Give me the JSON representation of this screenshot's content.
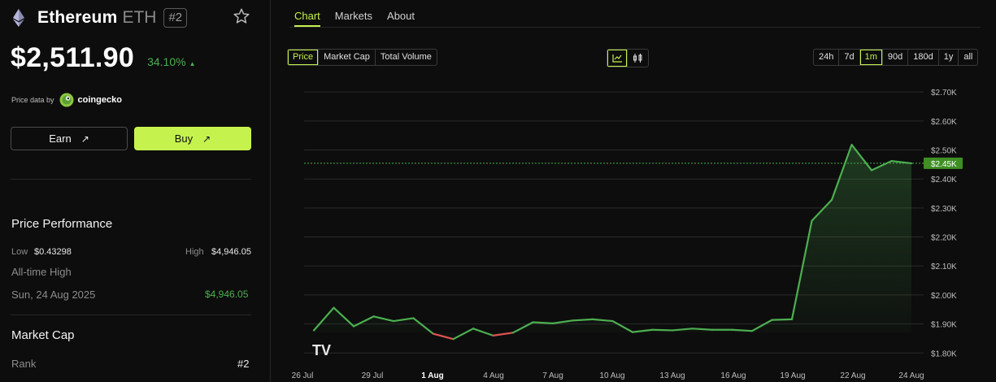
{
  "coin": {
    "name": "Ethereum",
    "symbol": "ETH",
    "rank_badge": "#2",
    "price": "$2,511.90",
    "change_pct": "34.10%",
    "price_data_label": "Price data by",
    "provider": "coingecko"
  },
  "actions": {
    "earn": "Earn",
    "buy": "Buy",
    "arrow": "↗"
  },
  "performance": {
    "title": "Price Performance",
    "low_label": "Low",
    "low_value": "$0.43298",
    "high_label": "High",
    "high_value": "$4,946.05",
    "ath_label": "All-time High",
    "ath_date": "Sun, 24 Aug 2025",
    "ath_value": "$4,946.05"
  },
  "market_cap": {
    "title": "Market Cap",
    "rank_label": "Rank",
    "rank_value": "#2"
  },
  "tabs": [
    {
      "label": "Chart",
      "active": true
    },
    {
      "label": "Markets",
      "active": false
    },
    {
      "label": "About",
      "active": false
    }
  ],
  "metric_options": [
    "Price",
    "Market Cap",
    "Total Volume"
  ],
  "metric_selected": "Price",
  "chart_type_icons": [
    "line-chart-icon",
    "candlestick-icon"
  ],
  "range_options": [
    "24h",
    "7d",
    "1m",
    "90d",
    "180d",
    "1y",
    "all"
  ],
  "range_selected": "1m",
  "colors": {
    "accent": "#c6f24e",
    "up": "#4caf50",
    "down": "#e05252",
    "grid": "#2a2a2a"
  },
  "chart_data": {
    "type": "line",
    "series": [
      {
        "values": [
          1878,
          1956,
          1892,
          1926,
          1910,
          1920,
          1866,
          1848,
          1884,
          1860,
          1870,
          1906,
          1902,
          1912,
          1916,
          1910,
          1872,
          1880,
          1878,
          1884,
          1880,
          1880,
          1876,
          1914,
          1916,
          2256,
          2328,
          2518,
          2430,
          2462,
          2454
        ]
      }
    ],
    "x_ticks": [
      "26 Jul",
      "29 Jul",
      "1 Aug",
      "4 Aug",
      "7 Aug",
      "10 Aug",
      "13 Aug",
      "16 Aug",
      "19 Aug",
      "22 Aug",
      "24 Aug"
    ],
    "x_tick_bold": "1 Aug",
    "y_ticks": [
      "$1.80K",
      "$1.90K",
      "$2.00K",
      "$2.10K",
      "$2.20K",
      "$2.30K",
      "$2.40K",
      "$2.50K",
      "$2.60K",
      "$2.70K"
    ],
    "ylim": [
      1770,
      2720
    ],
    "current_label": "$2.45K",
    "current_value": 2454,
    "grid": true,
    "watermark": "TV"
  }
}
